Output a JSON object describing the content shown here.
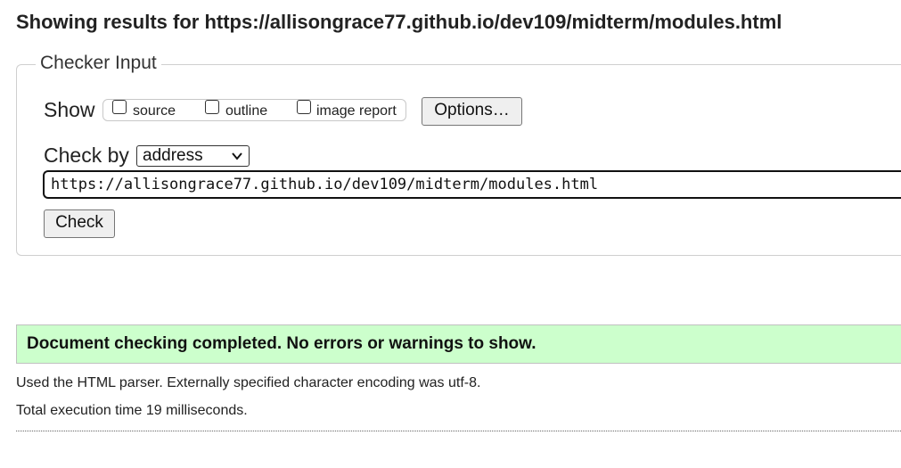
{
  "header": {
    "title": "Showing results for https://allisongrace77.github.io/dev109/midterm/modules.html"
  },
  "checker_input": {
    "legend": "Checker Input",
    "show_label": "Show",
    "options": [
      {
        "label": "source",
        "checked": false
      },
      {
        "label": "outline",
        "checked": false
      },
      {
        "label": "image report",
        "checked": false
      }
    ],
    "options_button": "Options…",
    "check_by_label": "Check by",
    "check_by_value": "address",
    "url_value": "https://allisongrace77.github.io/dev109/midterm/modules.html",
    "check_button": "Check"
  },
  "results": {
    "success_message": "Document checking completed. No errors or warnings to show.",
    "success_color": "#ccffcc",
    "parser_info": "Used the HTML parser. Externally specified character encoding was utf-8.",
    "execution_time": "Total execution time 19 milliseconds."
  }
}
